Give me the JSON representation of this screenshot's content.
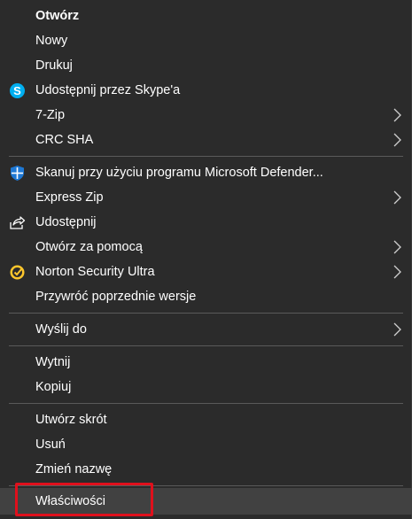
{
  "context_menu": {
    "items": [
      {
        "label": "Otwórz"
      },
      {
        "label": "Nowy"
      },
      {
        "label": "Drukuj"
      },
      {
        "label": "Udostępnij przez Skype'a"
      },
      {
        "label": "7-Zip"
      },
      {
        "label": "CRC SHA"
      },
      {
        "label": "Skanuj przy użyciu programu Microsoft Defender..."
      },
      {
        "label": "Express Zip"
      },
      {
        "label": "Udostępnij"
      },
      {
        "label": "Otwórz za pomocą"
      },
      {
        "label": "Norton Security Ultra"
      },
      {
        "label": "Przywróć poprzednie wersje"
      },
      {
        "label": "Wyślij do"
      },
      {
        "label": "Wytnij"
      },
      {
        "label": "Kopiuj"
      },
      {
        "label": "Utwórz skrót"
      },
      {
        "label": "Usuń"
      },
      {
        "label": "Zmień nazwę"
      },
      {
        "label": "Właściwości"
      }
    ],
    "icons": {
      "skype": "skype-icon",
      "defender": "microsoft-defender-icon",
      "share": "share-icon",
      "norton": "norton-icon",
      "submenu": "chevron-right-icon"
    },
    "colors": {
      "background": "#2b2b2b",
      "text": "#ffffff",
      "separator": "#5a5a5a",
      "hover": "#414141",
      "highlight_border": "#e0101c",
      "skype_blue": "#00aff0",
      "defender_blue": "#1e78d4",
      "norton_yellow": "#ffc72c"
    }
  }
}
